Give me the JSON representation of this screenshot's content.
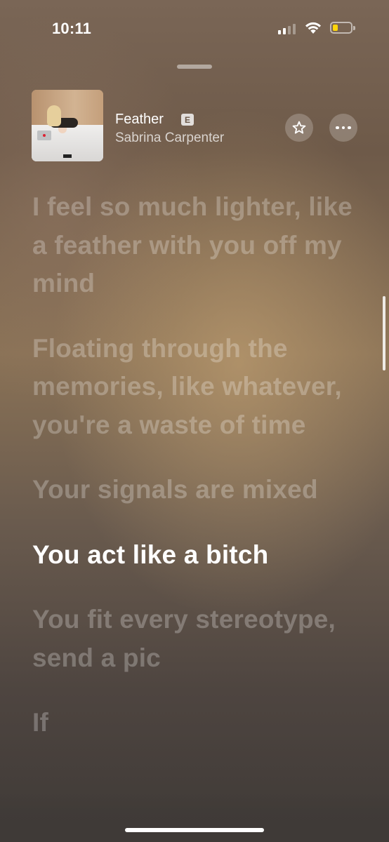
{
  "status_bar": {
    "time": "10:11",
    "signal_bars_filled": 2,
    "signal_bars_total": 4,
    "battery_level": 0.2,
    "battery_color": "#ffd60a"
  },
  "now_playing": {
    "title": "Feather",
    "explicit_badge": "E",
    "artist": "Sabrina Carpenter",
    "artwork_icon": "album-artwork",
    "favorite_icon": "star-icon",
    "more_icon": "ellipsis-icon"
  },
  "lyrics": [
    {
      "text": "I feel so much lighter, like a feather with you off my mind",
      "active": false
    },
    {
      "text": "Floating through the memories, like whatever, you're a waste of time",
      "active": false
    },
    {
      "text": "Your signals are mixed",
      "active": false
    },
    {
      "text": "You act like a bitch",
      "active": true
    },
    {
      "text": "You fit every stereotype, send a pic",
      "active": false
    },
    {
      "text": "If ",
      "active": false
    }
  ],
  "colors": {
    "active_lyric": "#ffffff",
    "inactive_lyric": "rgba(255,255,255,0.26)"
  }
}
